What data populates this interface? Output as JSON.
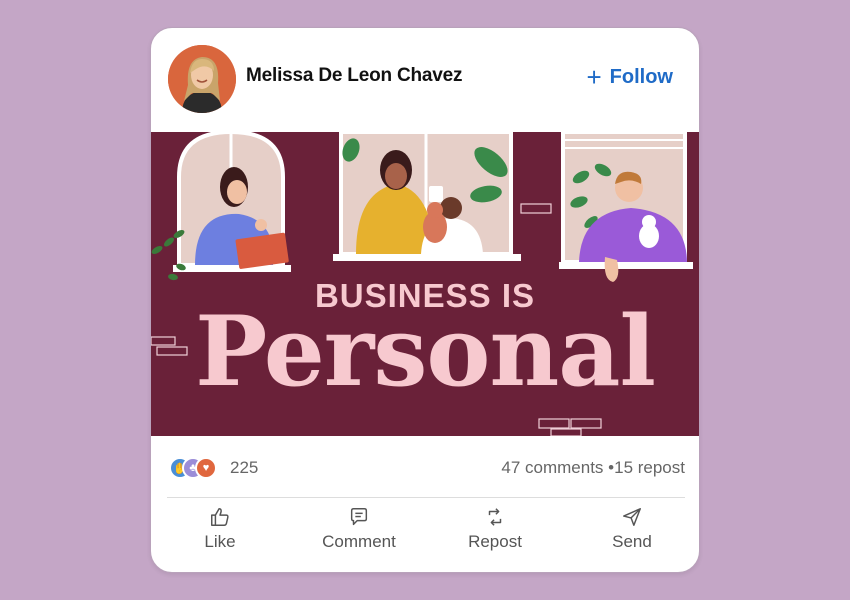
{
  "post": {
    "author": "Melissa De Leon Chavez",
    "follow_label": "Follow"
  },
  "banner": {
    "line1": "BUSINESS IS",
    "line2": "Personal",
    "background_color": "#6a2139",
    "text_color": "#f7c9cf"
  },
  "stats": {
    "reaction_count": "225",
    "comments": "47 comments",
    "separator": "•",
    "reposts": "15 repost",
    "reaction_icons": [
      "clap-icon",
      "support-icon",
      "love-icon"
    ]
  },
  "actions": [
    {
      "label": "Like",
      "icon": "thumbs-up-icon"
    },
    {
      "label": "Comment",
      "icon": "comment-icon"
    },
    {
      "label": "Repost",
      "icon": "repost-icon"
    },
    {
      "label": "Send",
      "icon": "send-icon"
    }
  ],
  "colors": {
    "page_background": "#c4a6c6",
    "accent": "#1f6bc7"
  }
}
